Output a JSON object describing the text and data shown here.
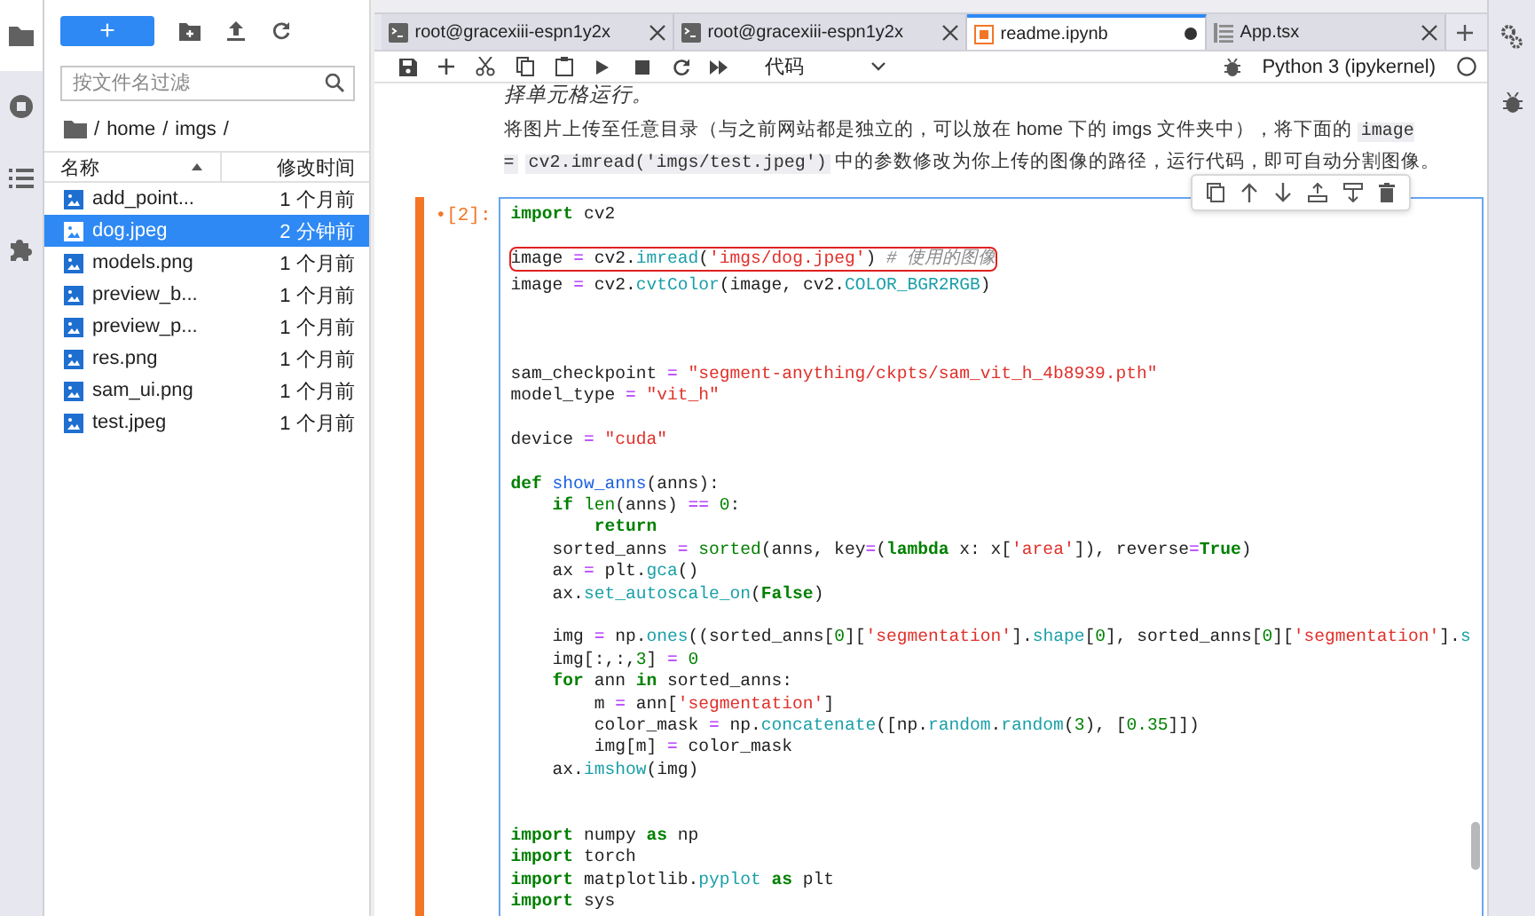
{
  "activity_bar": {
    "items": [
      {
        "kind": "folder",
        "selected": true
      },
      {
        "kind": "stop",
        "selected": false
      },
      {
        "kind": "list",
        "selected": false
      },
      {
        "kind": "puzzle",
        "selected": false
      }
    ]
  },
  "file_browser": {
    "new_button": "+",
    "filter": {
      "placeholder": "按文件名过滤"
    },
    "path": [
      "/",
      "home",
      "/",
      "imgs",
      "/"
    ],
    "columns": {
      "name": "名称",
      "modified": "修改时间"
    },
    "files": [
      {
        "name": "add_point...",
        "modified": "1 个月前",
        "selected": false
      },
      {
        "name": "dog.jpeg",
        "modified": "2 分钟前",
        "selected": true
      },
      {
        "name": "models.png",
        "modified": "1 个月前",
        "selected": false
      },
      {
        "name": "preview_b...",
        "modified": "1 个月前",
        "selected": false
      },
      {
        "name": "preview_p...",
        "modified": "1 个月前",
        "selected": false
      },
      {
        "name": "res.png",
        "modified": "1 个月前",
        "selected": false
      },
      {
        "name": "sam_ui.png",
        "modified": "1 个月前",
        "selected": false
      },
      {
        "name": "test.jpeg",
        "modified": "1 个月前",
        "selected": false
      }
    ]
  },
  "tabs": [
    {
      "label": "root@gracexiii-espn1y2x",
      "kind": "terminal",
      "selected": false,
      "unsaved": false
    },
    {
      "label": "root@gracexiii-espn1y2x",
      "kind": "terminal",
      "selected": false,
      "unsaved": false
    },
    {
      "label": "readme.ipynb",
      "kind": "notebook",
      "selected": true,
      "unsaved": true
    },
    {
      "label": "App.tsx",
      "kind": "file",
      "selected": false,
      "unsaved": false
    }
  ],
  "toolbar": {
    "cell_type": "代码",
    "kernel": "Python 3 (ipykernel)"
  },
  "markdown": {
    "cut_line": "择单元格运行。",
    "paragraph": [
      {
        "kind": "text",
        "text": "将图片上传至任意目录（与之前网站都是独立的，可以放在 home 下的 imgs 文件夹中），将下面的 "
      },
      {
        "kind": "code",
        "text": "image ="
      },
      {
        "kind": "code",
        "text": "cv2.imread('imgs/test.jpeg')"
      },
      {
        "kind": "text",
        "text": " 中的参数修改为你上传的图像的路径，运行代码，即可自动分割图像。"
      }
    ]
  },
  "cell": {
    "prompt": "•[2]:",
    "lines": [
      {
        "kind": "code",
        "tokens": [
          {
            "kind": "kw",
            "text": "import"
          },
          {
            "kind": "p",
            "text": " cv2"
          }
        ]
      },
      {
        "kind": "blank"
      },
      {
        "kind": "code",
        "highlighted": true,
        "tokens": [
          {
            "kind": "p",
            "text": "image "
          },
          {
            "kind": "op",
            "text": "="
          },
          {
            "kind": "p",
            "text": " cv2."
          },
          {
            "kind": "attr",
            "text": "imread"
          },
          {
            "kind": "p",
            "text": "("
          },
          {
            "kind": "str",
            "text": "'imgs/dog.jpeg'"
          },
          {
            "kind": "p",
            "text": ") "
          },
          {
            "kind": "cmt",
            "text": "# 使用的图像"
          }
        ]
      },
      {
        "kind": "code",
        "tokens": [
          {
            "kind": "p",
            "text": "image "
          },
          {
            "kind": "op",
            "text": "="
          },
          {
            "kind": "p",
            "text": " cv2."
          },
          {
            "kind": "attr",
            "text": "cvtColor"
          },
          {
            "kind": "p",
            "text": "(image, cv2."
          },
          {
            "kind": "attr",
            "text": "COLOR_BGR2RGB"
          },
          {
            "kind": "p",
            "text": ")"
          }
        ]
      },
      {
        "kind": "blank"
      },
      {
        "kind": "blank"
      },
      {
        "kind": "blank"
      },
      {
        "kind": "code",
        "tokens": [
          {
            "kind": "p",
            "text": "sam_checkpoint "
          },
          {
            "kind": "op",
            "text": "="
          },
          {
            "kind": "str",
            "text": " \"segment-anything/ckpts/sam_vit_h_4b8939.pth\""
          }
        ]
      },
      {
        "kind": "code",
        "tokens": [
          {
            "kind": "p",
            "text": "model_type "
          },
          {
            "kind": "op",
            "text": "="
          },
          {
            "kind": "str",
            "text": " \"vit_h\""
          }
        ]
      },
      {
        "kind": "blank"
      },
      {
        "kind": "code",
        "tokens": [
          {
            "kind": "p",
            "text": "device "
          },
          {
            "kind": "op",
            "text": "="
          },
          {
            "kind": "str",
            "text": " \"cuda\""
          }
        ]
      },
      {
        "kind": "blank"
      },
      {
        "kind": "code",
        "tokens": [
          {
            "kind": "kw",
            "text": "def"
          },
          {
            "kind": "fn",
            "text": " show_anns"
          },
          {
            "kind": "p",
            "text": "(anns):"
          }
        ]
      },
      {
        "kind": "code",
        "tokens": [
          {
            "kind": "kw",
            "text": "    if"
          },
          {
            "kind": "bi",
            "text": " len"
          },
          {
            "kind": "p",
            "text": "(anns) "
          },
          {
            "kind": "op",
            "text": "=="
          },
          {
            "kind": "num",
            "text": " 0"
          },
          {
            "kind": "p",
            "text": ":"
          }
        ]
      },
      {
        "kind": "code",
        "tokens": [
          {
            "kind": "kw",
            "text": "        return"
          }
        ]
      },
      {
        "kind": "code",
        "tokens": [
          {
            "kind": "p",
            "text": "    sorted_anns "
          },
          {
            "kind": "op",
            "text": "="
          },
          {
            "kind": "bi",
            "text": " sorted"
          },
          {
            "kind": "p",
            "text": "(anns, key"
          },
          {
            "kind": "op",
            "text": "="
          },
          {
            "kind": "p",
            "text": "("
          },
          {
            "kind": "kw",
            "text": "lambda"
          },
          {
            "kind": "p",
            "text": " x: x["
          },
          {
            "kind": "str",
            "text": "'area'"
          },
          {
            "kind": "p",
            "text": "]), reverse"
          },
          {
            "kind": "op",
            "text": "="
          },
          {
            "kind": "kw",
            "text": "True"
          },
          {
            "kind": "p",
            "text": ")"
          }
        ]
      },
      {
        "kind": "code",
        "tokens": [
          {
            "kind": "p",
            "text": "    ax "
          },
          {
            "kind": "op",
            "text": "="
          },
          {
            "kind": "p",
            "text": " plt."
          },
          {
            "kind": "attr",
            "text": "gca"
          },
          {
            "kind": "p",
            "text": "()"
          }
        ]
      },
      {
        "kind": "code",
        "tokens": [
          {
            "kind": "p",
            "text": "    ax."
          },
          {
            "kind": "attr",
            "text": "set_autoscale_on"
          },
          {
            "kind": "p",
            "text": "("
          },
          {
            "kind": "kw",
            "text": "False"
          },
          {
            "kind": "p",
            "text": ")"
          }
        ]
      },
      {
        "kind": "blank"
      },
      {
        "kind": "code",
        "tokens": [
          {
            "kind": "p",
            "text": "    img "
          },
          {
            "kind": "op",
            "text": "="
          },
          {
            "kind": "p",
            "text": " np."
          },
          {
            "kind": "attr",
            "text": "ones"
          },
          {
            "kind": "p",
            "text": "((sorted_anns["
          },
          {
            "kind": "num",
            "text": "0"
          },
          {
            "kind": "p",
            "text": "]["
          },
          {
            "kind": "str",
            "text": "'segmentation'"
          },
          {
            "kind": "p",
            "text": "]."
          },
          {
            "kind": "attr",
            "text": "shape"
          },
          {
            "kind": "p",
            "text": "["
          },
          {
            "kind": "num",
            "text": "0"
          },
          {
            "kind": "p",
            "text": "], sorted_anns["
          },
          {
            "kind": "num",
            "text": "0"
          },
          {
            "kind": "p",
            "text": "]["
          },
          {
            "kind": "str",
            "text": "'segmentation'"
          },
          {
            "kind": "p",
            "text": "]."
          },
          {
            "kind": "attr",
            "text": "s"
          }
        ]
      },
      {
        "kind": "code",
        "tokens": [
          {
            "kind": "p",
            "text": "    img[:,:,"
          },
          {
            "kind": "num",
            "text": "3"
          },
          {
            "kind": "p",
            "text": "] "
          },
          {
            "kind": "op",
            "text": "="
          },
          {
            "kind": "num",
            "text": " 0"
          }
        ]
      },
      {
        "kind": "code",
        "tokens": [
          {
            "kind": "kw",
            "text": "    for"
          },
          {
            "kind": "p",
            "text": " ann "
          },
          {
            "kind": "kw",
            "text": "in"
          },
          {
            "kind": "p",
            "text": " sorted_anns:"
          }
        ]
      },
      {
        "kind": "code",
        "tokens": [
          {
            "kind": "p",
            "text": "        m "
          },
          {
            "kind": "op",
            "text": "="
          },
          {
            "kind": "p",
            "text": " ann["
          },
          {
            "kind": "str",
            "text": "'segmentation'"
          },
          {
            "kind": "p",
            "text": "]"
          }
        ]
      },
      {
        "kind": "code",
        "tokens": [
          {
            "kind": "p",
            "text": "        color_mask "
          },
          {
            "kind": "op",
            "text": "="
          },
          {
            "kind": "p",
            "text": " np."
          },
          {
            "kind": "attr",
            "text": "concatenate"
          },
          {
            "kind": "p",
            "text": "([np."
          },
          {
            "kind": "attr",
            "text": "random"
          },
          {
            "kind": "p",
            "text": "."
          },
          {
            "kind": "attr",
            "text": "random"
          },
          {
            "kind": "p",
            "text": "("
          },
          {
            "kind": "num",
            "text": "3"
          },
          {
            "kind": "p",
            "text": "), ["
          },
          {
            "kind": "num",
            "text": "0.35"
          },
          {
            "kind": "p",
            "text": "]])"
          }
        ]
      },
      {
        "kind": "code",
        "tokens": [
          {
            "kind": "p",
            "text": "        img[m] "
          },
          {
            "kind": "op",
            "text": "="
          },
          {
            "kind": "p",
            "text": " color_mask"
          }
        ]
      },
      {
        "kind": "code",
        "tokens": [
          {
            "kind": "p",
            "text": "    ax."
          },
          {
            "kind": "attr",
            "text": "imshow"
          },
          {
            "kind": "p",
            "text": "(img)"
          }
        ]
      },
      {
        "kind": "blank"
      },
      {
        "kind": "blank"
      },
      {
        "kind": "code",
        "tokens": [
          {
            "kind": "kw",
            "text": "import"
          },
          {
            "kind": "p",
            "text": " numpy "
          },
          {
            "kind": "kw",
            "text": "as"
          },
          {
            "kind": "p",
            "text": " np"
          }
        ]
      },
      {
        "kind": "code",
        "tokens": [
          {
            "kind": "kw",
            "text": "import"
          },
          {
            "kind": "p",
            "text": " torch"
          }
        ]
      },
      {
        "kind": "code",
        "tokens": [
          {
            "kind": "kw",
            "text": "import"
          },
          {
            "kind": "p",
            "text": " matplotlib."
          },
          {
            "kind": "attr",
            "text": "pyplot"
          },
          {
            "kind": "kw",
            "text": " as"
          },
          {
            "kind": "p",
            "text": " plt"
          }
        ]
      },
      {
        "kind": "code",
        "tokens": [
          {
            "kind": "kw",
            "text": "import"
          },
          {
            "kind": "p",
            "text": " sys"
          }
        ]
      }
    ]
  }
}
